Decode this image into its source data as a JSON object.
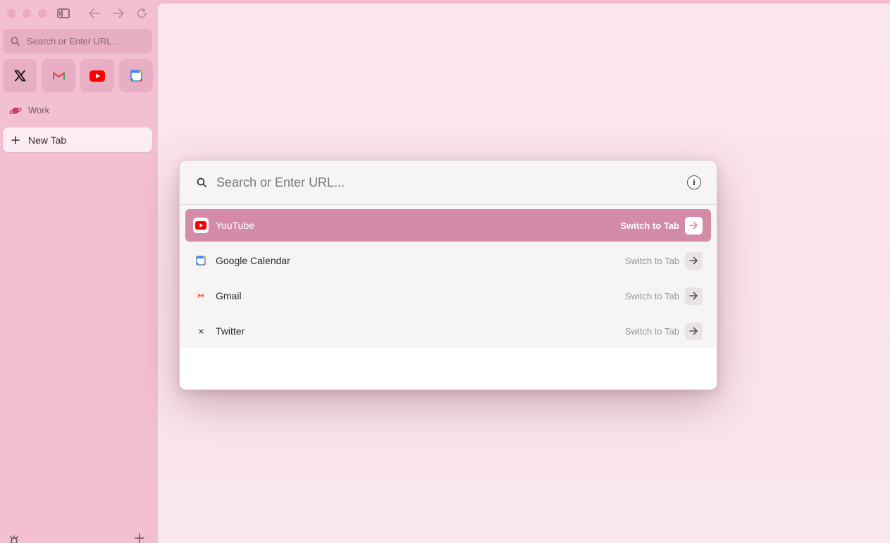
{
  "sidebar": {
    "search_placeholder": "Search or Enter URL...",
    "pinned": [
      {
        "name": "X",
        "icon": "x-logo-icon"
      },
      {
        "name": "Gmail",
        "icon": "gmail-icon"
      },
      {
        "name": "YouTube",
        "icon": "youtube-icon"
      },
      {
        "name": "Google Calendar",
        "icon": "calendar-icon"
      }
    ],
    "space_label": "Work",
    "new_tab_label": "New Tab"
  },
  "palette": {
    "search_placeholder": "Search or Enter URL...",
    "results": [
      {
        "title": "YouTube",
        "action": "Switch to Tab",
        "selected": true
      },
      {
        "title": "Google Calendar",
        "action": "Switch to Tab",
        "selected": false
      },
      {
        "title": "Gmail",
        "action": "Switch to Tab",
        "selected": false
      },
      {
        "title": "Twitter",
        "action": "Switch to Tab",
        "selected": false
      }
    ]
  },
  "colors": {
    "sidebar_bg": "#f3bfd2",
    "accent": "#d48ba9",
    "youtube_red": "#ff0000"
  }
}
